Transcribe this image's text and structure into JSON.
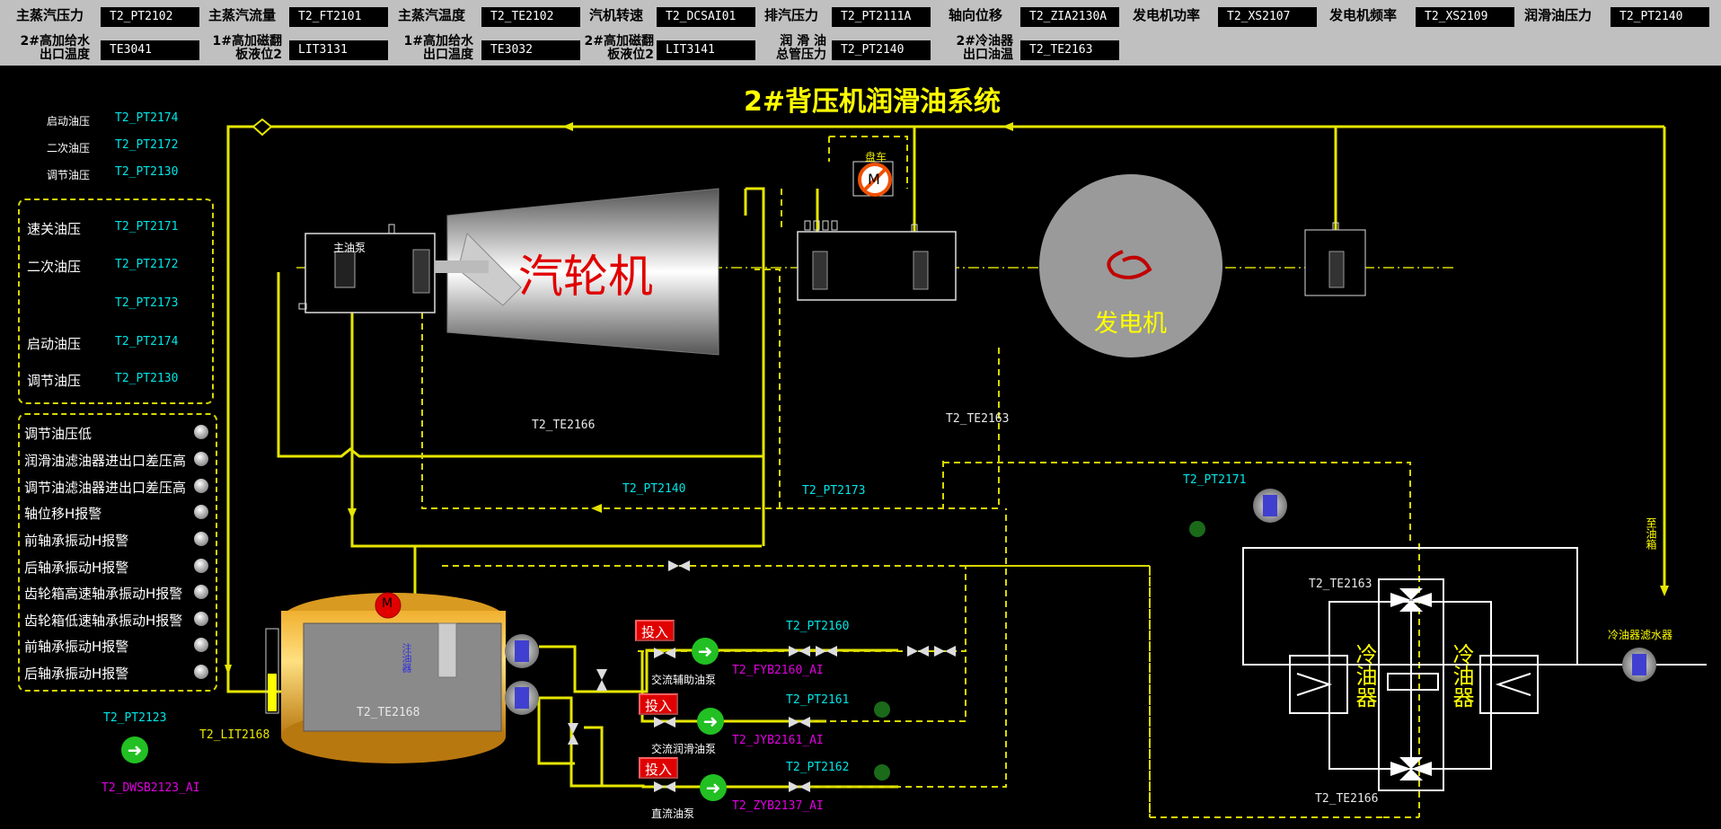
{
  "header": {
    "row1": [
      {
        "label": "主蒸汽压力",
        "value": "T2_PT2102"
      },
      {
        "label": "主蒸汽流量",
        "value": "T2_FT2101"
      },
      {
        "label": "主蒸汽温度",
        "value": "T2_TE2102"
      },
      {
        "label": "汽机转速",
        "value": "T2_DCSAI01"
      },
      {
        "label": "排汽压力",
        "value": "T2_PT2111A"
      },
      {
        "label": "轴向位移",
        "value": "T2_ZIA2130A"
      },
      {
        "label": "发电机功率",
        "value": "T2_XS2107"
      },
      {
        "label": "发电机频率",
        "value": "T2_XS2109"
      },
      {
        "label": "润滑油压力",
        "value": "T2_PT2140"
      }
    ],
    "row2": [
      {
        "label_a": "2#高加给水",
        "label_b": "出口温度",
        "value": "TE3041"
      },
      {
        "label_a": "1#高加磁翻",
        "label_b": "板液位2",
        "value": "LIT3131"
      },
      {
        "label_a": "1#高加给水",
        "label_b": "出口温度",
        "value": "TE3032"
      },
      {
        "label_a": "2#高加磁翻",
        "label_b": "板液位2",
        "value": "LIT3141"
      },
      {
        "label_a": "润 滑 油",
        "label_b": "总管压力",
        "value": "T2_PT2140"
      },
      {
        "label_a": "2#冷油器",
        "label_b": "出口油温",
        "value": "T2_TE2163"
      }
    ]
  },
  "title": "2#背压机润滑油系统",
  "small_pressures": [
    {
      "label": "启动油压",
      "tag": "T2_PT2174"
    },
    {
      "label": "二次油压",
      "tag": "T2_PT2172"
    },
    {
      "label": "调节油压",
      "tag": "T2_PT2130"
    }
  ],
  "pressure_panel": [
    {
      "label": "速关油压",
      "tag": "T2_PT2171"
    },
    {
      "label": "二次油压",
      "tag": "T2_PT2172"
    },
    {
      "label": "",
      "tag": "T2_PT2173"
    },
    {
      "label": "启动油压",
      "tag": "T2_PT2174"
    },
    {
      "label": "调节油压",
      "tag": "T2_PT2130"
    }
  ],
  "alarms": [
    "调节油压低",
    "润滑油滤油器进出口差压高",
    "调节油滤油器进出口差压高",
    "轴位移H报警",
    "前轴承振动H报警",
    "后轴承振动H报警",
    "齿轮箱高速轴承振动H报警",
    "齿轮箱低速轴承振动H报警",
    "前轴承振动H报警",
    "后轴承振动H报警"
  ],
  "diagram": {
    "turbine": "汽轮机",
    "generator": "发电机",
    "main_pump": "主油泵",
    "turning_gear": "盘车",
    "motor": "M",
    "injector": "注油器",
    "cooler": "冷油器",
    "to_drain": "至油箱",
    "filter_label": "冷油器滤水器",
    "tank_temp": "T2_TE2168",
    "tank_level": "T2_LIT2168",
    "te2166_top": "T2_TE2166",
    "te2163_top": "T2_TE2163",
    "pt2140": "T2_PT2140",
    "pt2173": "T2_PT2173",
    "pt2171": "T2_PT2171",
    "pt2123": "T2_PT2123",
    "dwsb": "T2_DWSB2123_AI",
    "cooler_te2163": "T2_TE2163",
    "cooler_te2166": "T2_TE2166",
    "pumps": [
      {
        "btn": "投入",
        "name": "交流辅助油泵",
        "pt": "T2_PT2160",
        "fyb": "T2_FYB2160_AI"
      },
      {
        "btn": "投入",
        "name": "交流润滑油泵",
        "pt": "T2_PT2161",
        "fyb": "T2_JYB2161_AI"
      },
      {
        "btn": "投入",
        "name": "直流油泵",
        "pt": "T2_PT2162",
        "fyb": "T2_ZYB2137_AI"
      }
    ]
  }
}
